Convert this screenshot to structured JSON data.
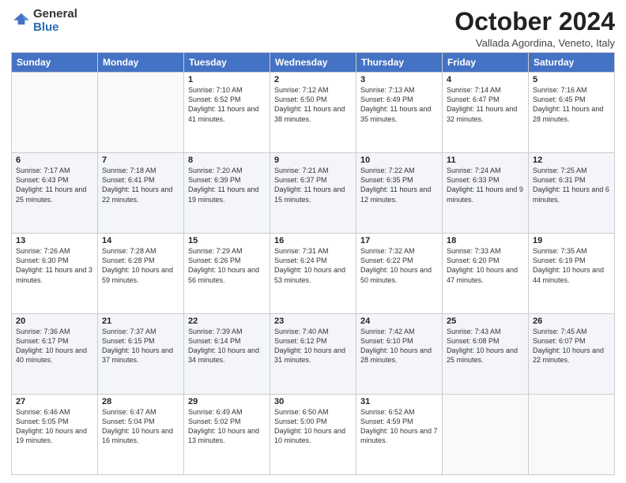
{
  "logo": {
    "line1": "General",
    "line2": "Blue"
  },
  "title": "October 2024",
  "subtitle": "Vallada Agordina, Veneto, Italy",
  "days_of_week": [
    "Sunday",
    "Monday",
    "Tuesday",
    "Wednesday",
    "Thursday",
    "Friday",
    "Saturday"
  ],
  "weeks": [
    [
      {
        "num": "",
        "info": ""
      },
      {
        "num": "",
        "info": ""
      },
      {
        "num": "1",
        "info": "Sunrise: 7:10 AM\nSunset: 6:52 PM\nDaylight: 11 hours and 41 minutes."
      },
      {
        "num": "2",
        "info": "Sunrise: 7:12 AM\nSunset: 6:50 PM\nDaylight: 11 hours and 38 minutes."
      },
      {
        "num": "3",
        "info": "Sunrise: 7:13 AM\nSunset: 6:49 PM\nDaylight: 11 hours and 35 minutes."
      },
      {
        "num": "4",
        "info": "Sunrise: 7:14 AM\nSunset: 6:47 PM\nDaylight: 11 hours and 32 minutes."
      },
      {
        "num": "5",
        "info": "Sunrise: 7:16 AM\nSunset: 6:45 PM\nDaylight: 11 hours and 28 minutes."
      }
    ],
    [
      {
        "num": "6",
        "info": "Sunrise: 7:17 AM\nSunset: 6:43 PM\nDaylight: 11 hours and 25 minutes."
      },
      {
        "num": "7",
        "info": "Sunrise: 7:18 AM\nSunset: 6:41 PM\nDaylight: 11 hours and 22 minutes."
      },
      {
        "num": "8",
        "info": "Sunrise: 7:20 AM\nSunset: 6:39 PM\nDaylight: 11 hours and 19 minutes."
      },
      {
        "num": "9",
        "info": "Sunrise: 7:21 AM\nSunset: 6:37 PM\nDaylight: 11 hours and 15 minutes."
      },
      {
        "num": "10",
        "info": "Sunrise: 7:22 AM\nSunset: 6:35 PM\nDaylight: 11 hours and 12 minutes."
      },
      {
        "num": "11",
        "info": "Sunrise: 7:24 AM\nSunset: 6:33 PM\nDaylight: 11 hours and 9 minutes."
      },
      {
        "num": "12",
        "info": "Sunrise: 7:25 AM\nSunset: 6:31 PM\nDaylight: 11 hours and 6 minutes."
      }
    ],
    [
      {
        "num": "13",
        "info": "Sunrise: 7:26 AM\nSunset: 6:30 PM\nDaylight: 11 hours and 3 minutes."
      },
      {
        "num": "14",
        "info": "Sunrise: 7:28 AM\nSunset: 6:28 PM\nDaylight: 10 hours and 59 minutes."
      },
      {
        "num": "15",
        "info": "Sunrise: 7:29 AM\nSunset: 6:26 PM\nDaylight: 10 hours and 56 minutes."
      },
      {
        "num": "16",
        "info": "Sunrise: 7:31 AM\nSunset: 6:24 PM\nDaylight: 10 hours and 53 minutes."
      },
      {
        "num": "17",
        "info": "Sunrise: 7:32 AM\nSunset: 6:22 PM\nDaylight: 10 hours and 50 minutes."
      },
      {
        "num": "18",
        "info": "Sunrise: 7:33 AM\nSunset: 6:20 PM\nDaylight: 10 hours and 47 minutes."
      },
      {
        "num": "19",
        "info": "Sunrise: 7:35 AM\nSunset: 6:19 PM\nDaylight: 10 hours and 44 minutes."
      }
    ],
    [
      {
        "num": "20",
        "info": "Sunrise: 7:36 AM\nSunset: 6:17 PM\nDaylight: 10 hours and 40 minutes."
      },
      {
        "num": "21",
        "info": "Sunrise: 7:37 AM\nSunset: 6:15 PM\nDaylight: 10 hours and 37 minutes."
      },
      {
        "num": "22",
        "info": "Sunrise: 7:39 AM\nSunset: 6:14 PM\nDaylight: 10 hours and 34 minutes."
      },
      {
        "num": "23",
        "info": "Sunrise: 7:40 AM\nSunset: 6:12 PM\nDaylight: 10 hours and 31 minutes."
      },
      {
        "num": "24",
        "info": "Sunrise: 7:42 AM\nSunset: 6:10 PM\nDaylight: 10 hours and 28 minutes."
      },
      {
        "num": "25",
        "info": "Sunrise: 7:43 AM\nSunset: 6:08 PM\nDaylight: 10 hours and 25 minutes."
      },
      {
        "num": "26",
        "info": "Sunrise: 7:45 AM\nSunset: 6:07 PM\nDaylight: 10 hours and 22 minutes."
      }
    ],
    [
      {
        "num": "27",
        "info": "Sunrise: 6:46 AM\nSunset: 5:05 PM\nDaylight: 10 hours and 19 minutes."
      },
      {
        "num": "28",
        "info": "Sunrise: 6:47 AM\nSunset: 5:04 PM\nDaylight: 10 hours and 16 minutes."
      },
      {
        "num": "29",
        "info": "Sunrise: 6:49 AM\nSunset: 5:02 PM\nDaylight: 10 hours and 13 minutes."
      },
      {
        "num": "30",
        "info": "Sunrise: 6:50 AM\nSunset: 5:00 PM\nDaylight: 10 hours and 10 minutes."
      },
      {
        "num": "31",
        "info": "Sunrise: 6:52 AM\nSunset: 4:59 PM\nDaylight: 10 hours and 7 minutes."
      },
      {
        "num": "",
        "info": ""
      },
      {
        "num": "",
        "info": ""
      }
    ]
  ]
}
